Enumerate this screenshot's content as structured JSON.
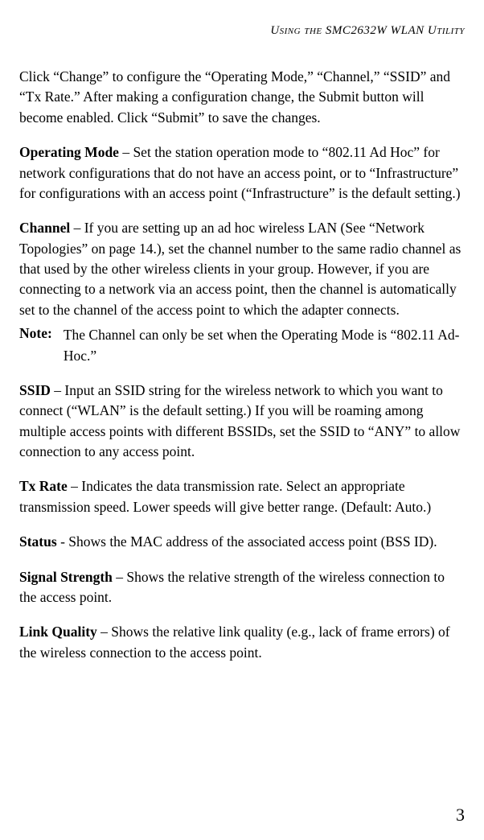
{
  "running_head": "Using the SMC2632W WLAN Utility",
  "intro": "Click “Change” to configure the “Operating Mode,” “Channel,” “SSID” and “Tx Rate.” After making a configuration change, the Submit button will become enabled. Click “Submit” to save the changes.",
  "operating_mode": {
    "title": "Operating Mode",
    "body": " – Set the station operation mode to “802.11 Ad Hoc” for network configurations that do not have an access point, or to “Infrastructure” for configurations with an access point (“Infrastructure” is the default setting.)"
  },
  "channel": {
    "title": "Channel",
    "body": " – If you are setting up an ad hoc wireless LAN (See “Network Topologies” on page 14.), set the channel number to the same radio channel as that used by the other wireless clients in your group. However, if you are connecting to a network via an access point, then the channel is automatically set to the channel of the access point to which the adapter connects."
  },
  "note": {
    "label": "Note:",
    "body": "The Channel can only be set when the Operating Mode is “802.11 Ad-Hoc.”"
  },
  "ssid": {
    "title": "SSID",
    "body": " – Input an SSID string for the wireless network to which you want to connect (“WLAN” is the default setting.) If you will be roaming among multiple access points with different BSSIDs, set the SSID to “ANY” to allow connection to any access point."
  },
  "tx_rate": {
    "title": "Tx Rate",
    "body": " – Indicates the data transmission rate. Select an appropriate transmission speed. Lower speeds will give better range. (Default: Auto.)"
  },
  "status": {
    "title": "Status",
    "body": " - Shows the MAC address of the associated access point (BSS ID)."
  },
  "signal_strength": {
    "title": "Signal Strength",
    "body": " – Shows the relative strength of the wireless connection to the access point."
  },
  "link_quality": {
    "title": "Link Quality",
    "body": " – Shows the relative link quality (e.g., lack of frame errors) of the wireless connection to the access point."
  },
  "page_number": "3"
}
